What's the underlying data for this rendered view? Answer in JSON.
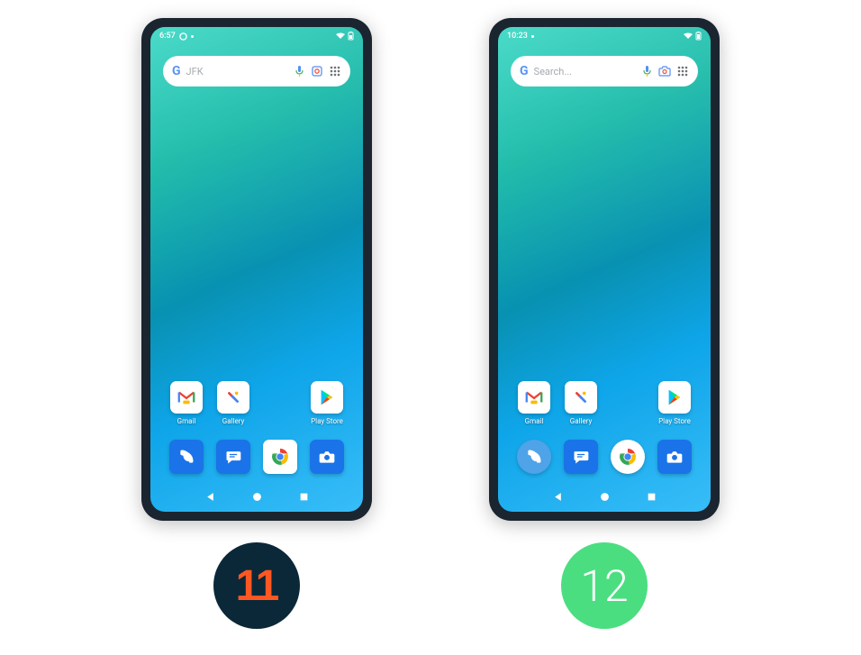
{
  "phones": [
    {
      "status_time": "6:57",
      "search_text": "JFK",
      "apps": [
        {
          "label": "Gmail",
          "icon": "gmail"
        },
        {
          "label": "Gallery",
          "icon": "gallery"
        },
        {
          "label": "",
          "icon": ""
        },
        {
          "label": "Play Store",
          "icon": "playstore"
        }
      ],
      "dock": [
        {
          "icon": "phone",
          "bg": "#1a73e8"
        },
        {
          "icon": "messages",
          "bg": "#1a73e8"
        },
        {
          "icon": "chrome",
          "bg": "#fff"
        },
        {
          "icon": "camera",
          "bg": "#1a73e8"
        }
      ],
      "search_cam_style": "lens",
      "version": "11",
      "badge_class": "badge-11"
    },
    {
      "status_time": "10:23",
      "search_text": "Search...",
      "apps": [
        {
          "label": "Gmail",
          "icon": "gmail"
        },
        {
          "label": "Gallery",
          "icon": "gallery"
        },
        {
          "label": "",
          "icon": ""
        },
        {
          "label": "Play Store",
          "icon": "playstore"
        }
      ],
      "dock": [
        {
          "icon": "phone",
          "bg": "#4fa3e8"
        },
        {
          "icon": "messages",
          "bg": "#1a73e8"
        },
        {
          "icon": "chrome",
          "bg": "#fff"
        },
        {
          "icon": "camera",
          "bg": "#1a73e8"
        }
      ],
      "search_cam_style": "camera",
      "version": "12",
      "badge_class": "badge-12"
    }
  ]
}
